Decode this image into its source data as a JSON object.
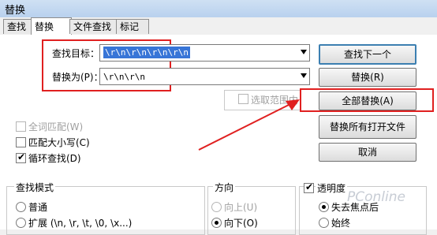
{
  "window": {
    "title": "替换"
  },
  "tabs": [
    {
      "label": "查找"
    },
    {
      "label": "替换"
    },
    {
      "label": "文件查找"
    },
    {
      "label": "标记"
    }
  ],
  "find": {
    "label": "查找目标：",
    "value": "\\r\\n\\r\\n\\r\\n\\r\\n"
  },
  "replace": {
    "label": "替换为(P)：",
    "value": "\\r\\n\\r\\n"
  },
  "selection_range": {
    "label": "选取范围内"
  },
  "buttons": {
    "find_next": "查找下一个",
    "replace": "替换(R)",
    "replace_all": "全部替换(A)",
    "replace_all_open": "替换所有打开文件",
    "cancel": "取消"
  },
  "options": {
    "whole_word": "全词匹配(W)",
    "match_case": "匹配大小写(C)",
    "wrap_around": "循环查找(D)"
  },
  "search_mode": {
    "title": "查找模式",
    "normal": "普通",
    "extended": "扩展 (\\n, \\r, \\t, \\0, \\x...)"
  },
  "direction": {
    "title": "方向",
    "up": "向上(U)",
    "down": "向下(O)"
  },
  "transparency": {
    "title": "透明度",
    "on_lose_focus": "失去焦点后",
    "always": "始终"
  },
  "watermark": "PConline"
}
